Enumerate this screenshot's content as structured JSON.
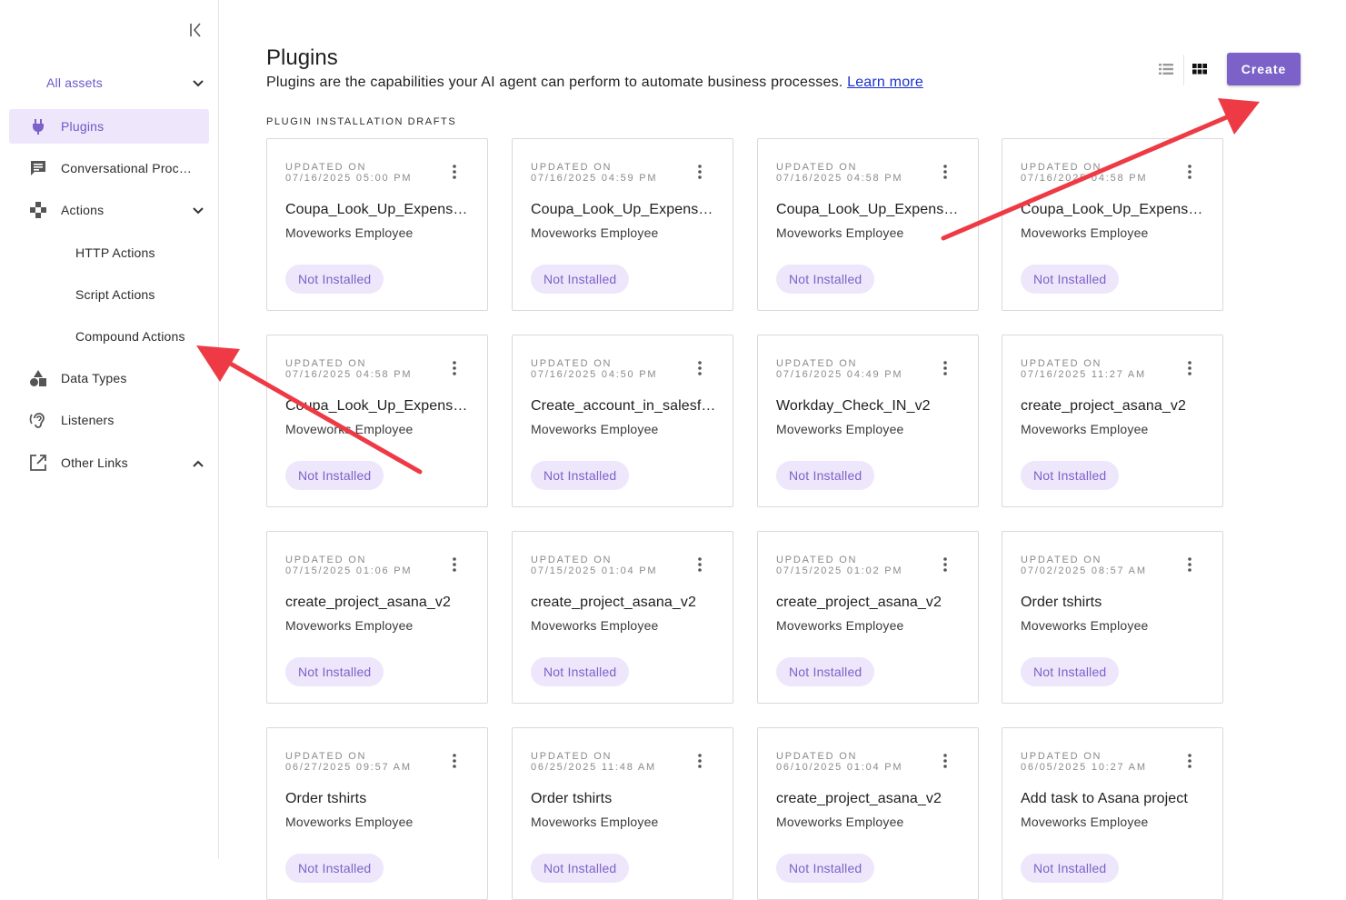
{
  "sidebar": {
    "assets_label": "All assets",
    "items": [
      {
        "label": "Plugins",
        "icon": "plug-icon",
        "active": true
      },
      {
        "label": "Conversational Processes",
        "icon": "chat-icon"
      },
      {
        "label": "Actions",
        "icon": "actions-icon"
      },
      {
        "label": "Data Types",
        "icon": "shapes-icon"
      },
      {
        "label": "Listeners",
        "icon": "ear-icon"
      },
      {
        "label": "Other Links",
        "icon": "external-link-icon"
      }
    ],
    "action_subitems": [
      "HTTP Actions",
      "Script Actions",
      "Compound Actions"
    ]
  },
  "header": {
    "title": "Plugins",
    "subtitle": "Plugins are the capabilities your AI agent can perform to automate business processes.",
    "learn_more": "Learn more",
    "create_label": "Create"
  },
  "section_label": "PLUGIN INSTALLATION DRAFTS",
  "card_updated_label": "UPDATED ON",
  "cards": [
    {
      "updated": "07/16/2025 05:00 PM",
      "name": "Coupa_Look_Up_Expense_Report",
      "owner": "Moveworks Employee",
      "status": "Not Installed"
    },
    {
      "updated": "07/16/2025 04:59 PM",
      "name": "Coupa_Look_Up_Expense_Report",
      "owner": "Moveworks Employee",
      "status": "Not Installed"
    },
    {
      "updated": "07/16/2025 04:58 PM",
      "name": "Coupa_Look_Up_Expense_Report",
      "owner": "Moveworks Employee",
      "status": "Not Installed"
    },
    {
      "updated": "07/16/2025 04:58 PM",
      "name": "Coupa_Look_Up_Expense_Report",
      "owner": "Moveworks Employee",
      "status": "Not Installed"
    },
    {
      "updated": "07/16/2025 04:58 PM",
      "name": "Coupa_Look_Up_Expense_Report",
      "owner": "Moveworks Employee",
      "status": "Not Installed"
    },
    {
      "updated": "07/16/2025 04:50 PM",
      "name": "Create_account_in_salesforce",
      "owner": "Moveworks Employee",
      "status": "Not Installed"
    },
    {
      "updated": "07/16/2025 04:49 PM",
      "name": "Workday_Check_IN_v2",
      "owner": "Moveworks Employee",
      "status": "Not Installed"
    },
    {
      "updated": "07/16/2025 11:27 AM",
      "name": "create_project_asana_v2",
      "owner": "Moveworks Employee",
      "status": "Not Installed"
    },
    {
      "updated": "07/15/2025 01:06 PM",
      "name": "create_project_asana_v2",
      "owner": "Moveworks Employee",
      "status": "Not Installed"
    },
    {
      "updated": "07/15/2025 01:04 PM",
      "name": "create_project_asana_v2",
      "owner": "Moveworks Employee",
      "status": "Not Installed"
    },
    {
      "updated": "07/15/2025 01:02 PM",
      "name": "create_project_asana_v2",
      "owner": "Moveworks Employee",
      "status": "Not Installed"
    },
    {
      "updated": "07/02/2025 08:57 AM",
      "name": "Order tshirts",
      "owner": "Moveworks Employee",
      "status": "Not Installed"
    },
    {
      "updated": "06/27/2025 09:57 AM",
      "name": "Order tshirts",
      "owner": "Moveworks Employee",
      "status": "Not Installed"
    },
    {
      "updated": "06/25/2025 11:48 AM",
      "name": "Order tshirts",
      "owner": "Moveworks Employee",
      "status": "Not Installed"
    },
    {
      "updated": "06/10/2025 01:04 PM",
      "name": "create_project_asana_v2",
      "owner": "Moveworks Employee",
      "status": "Not Installed"
    },
    {
      "updated": "06/05/2025 10:27 AM",
      "name": "Add task to Asana project",
      "owner": "Moveworks Employee",
      "status": "Not Installed"
    }
  ],
  "colors": {
    "accent": "#7c62c8",
    "accent_light": "#eee6fb",
    "annotation_arrow": "#ee3a45"
  }
}
